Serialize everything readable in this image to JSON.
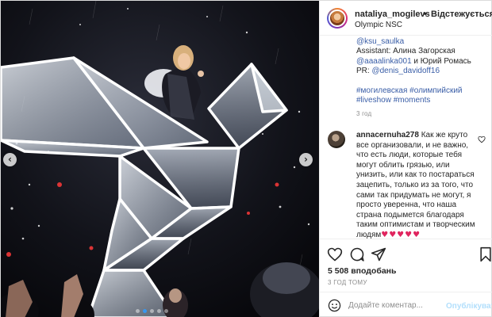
{
  "header": {
    "username": "nataliya_mogilevs",
    "separator": "•",
    "follow_label": "Відстежується",
    "location": "Olympic NSC"
  },
  "caption": {
    "lines": [
      {
        "text": "@ksu_saulka",
        "kind": "link"
      },
      {
        "text": "Assistant: Алина Загорская",
        "kind": "text"
      }
    ],
    "mention_line": {
      "link1": "@aaaalinka001",
      "text": " и Юрий Ромась"
    },
    "pr_line": {
      "prefix": "PR: ",
      "link": "@denis_davidoff16"
    },
    "hashtags1": "#могилевская #олимпийский",
    "hashtags2": "#liveshow #moments",
    "time": "3 год"
  },
  "comment": {
    "username": "annacernuha278",
    "first_line_text": " Как же круто",
    "lines": [
      "все организовали, и не важно,",
      "что есть люди, которые тебя",
      "могут облить грязью, или",
      "унизить, или как то постараться",
      "зацепить, только из за того, что",
      "сами так придумать не могут, я",
      "просто уверенна, что наша",
      "страна подымется благодаря",
      "таким оптимистам и творческим"
    ],
    "last_line_text": "людям",
    "hearts": "♥♥♥♥♥"
  },
  "actions": {
    "likes": "5 508 вподобань",
    "time": "3 ГОД ТОМУ"
  },
  "add_comment": {
    "placeholder": "Додайте коментар...",
    "publish_label": "Опублікувати"
  },
  "media": {
    "prev_arrow": "‹",
    "next_arrow": "›",
    "dots_count": 5,
    "active_dot": 1
  },
  "colors": {
    "link": "#3a5ea7",
    "heart": "#e0245e",
    "publish_disabled": "#b2dffc",
    "accent": "#3897f0"
  },
  "icons": [
    "heart-icon",
    "comment-icon",
    "share-icon",
    "bookmark-icon",
    "emoji-icon",
    "chevron-left-icon",
    "chevron-right-icon"
  ]
}
